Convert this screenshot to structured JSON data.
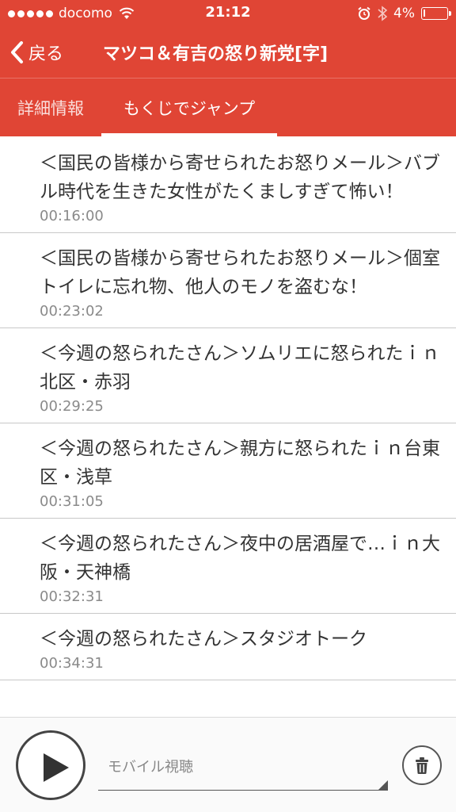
{
  "status_bar": {
    "carrier": "docomo",
    "time": "21:12",
    "battery": "4%",
    "battery_level": 0.04
  },
  "nav": {
    "back_label": "戻る",
    "title": "マツコ＆有吉の怒り新党[字]"
  },
  "tabs": [
    {
      "label": "詳細情報",
      "active": false
    },
    {
      "label": "もくじでジャンプ",
      "active": true
    }
  ],
  "chapters": [
    {
      "title": "＜国民の皆様から寄せられたお怒りメール＞バブル時代を生きた女性がたくましすぎて怖い！",
      "time": "00:16:00"
    },
    {
      "title": "＜国民の皆様から寄せられたお怒りメール＞個室トイレに忘れ物、他人のモノを盗むな！",
      "time": "00:23:02"
    },
    {
      "title": "＜今週の怒られたさん＞ソムリエに怒られたｉｎ北区・赤羽",
      "time": "00:29:25"
    },
    {
      "title": "＜今週の怒られたさん＞親方に怒られたｉｎ台東区・浅草",
      "time": "00:31:05"
    },
    {
      "title": "＜今週の怒られたさん＞夜中の居酒屋で…ｉｎ大阪・天神橋",
      "time": "00:32:31"
    },
    {
      "title": "＜今週の怒られたさん＞スタジオトーク",
      "time": "00:34:31"
    }
  ],
  "player": {
    "mode_label": "モバイル視聴",
    "play_icon": "play-icon",
    "delete_icon": "trash-icon"
  },
  "colors": {
    "accent": "#e04535",
    "text": "#333333",
    "subtext": "#8a8a8a"
  }
}
